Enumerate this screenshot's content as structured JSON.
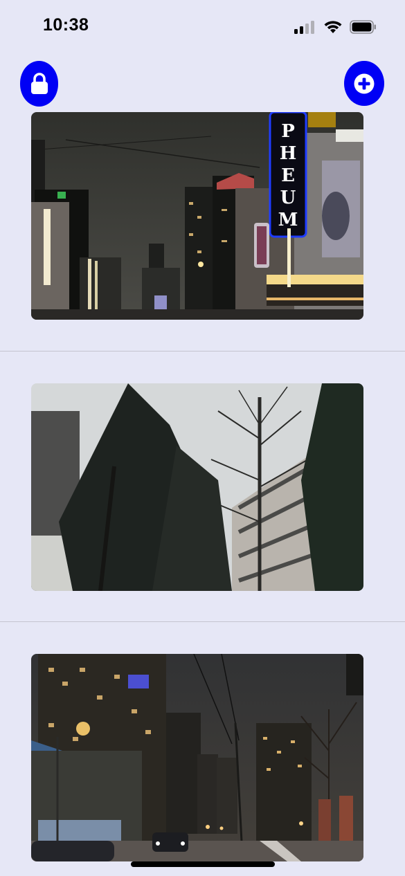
{
  "status_bar": {
    "time": "10:38",
    "icons": [
      "cellular-signal-icon",
      "wifi-icon",
      "battery-icon"
    ]
  },
  "toolbar": {
    "lock_button_icon": "lock-icon",
    "add_button_icon": "plus-icon",
    "accent_color": "#0000f5"
  },
  "photos": [
    {
      "subject": "night-city-street-theatre-sign",
      "sign_text": "PHEUM"
    },
    {
      "subject": "trees-and-building-overcast"
    },
    {
      "subject": "night-city-street-towers"
    }
  ],
  "colors": {
    "background": "#e6e7f6",
    "separator": "#c4c4cf"
  }
}
